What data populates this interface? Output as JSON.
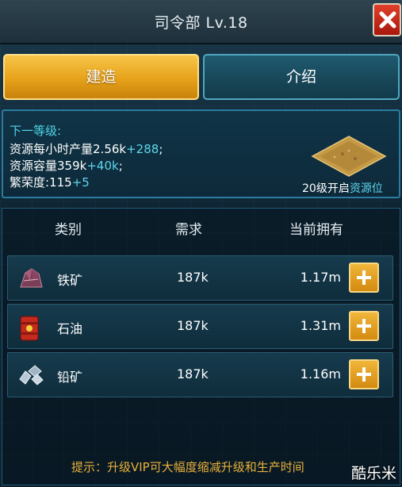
{
  "title": "司令部 Lv.18",
  "tabs": [
    {
      "label": "建造",
      "active": true
    },
    {
      "label": "介绍",
      "active": false
    }
  ],
  "next_level": {
    "heading": "下一等级:",
    "hourly_output": {
      "label": "资源每小时产量",
      "value": "2.56k",
      "bonus": "+288",
      "suffix": ";"
    },
    "capacity": {
      "label": "资源容量",
      "value": "359k",
      "bonus": "+40k",
      "suffix": ";"
    },
    "prosperity": {
      "label": "繁荣度:",
      "value": "115",
      "bonus": "+5"
    },
    "unlock_text": "20级开启",
    "unlock_highlight": "资源位"
  },
  "table": {
    "headers": [
      "类别",
      "需求",
      "当前拥有"
    ],
    "rows": [
      {
        "icon": "iron-ore-icon",
        "name": "铁矿",
        "need": "187k",
        "have": "1.17m"
      },
      {
        "icon": "oil-barrel-icon",
        "name": "石油",
        "need": "187k",
        "have": "1.31m"
      },
      {
        "icon": "lead-ore-icon",
        "name": "铅矿",
        "need": "187k",
        "have": "1.16m"
      }
    ]
  },
  "tip": "提示：升级VIP可大幅度缩减升级和生产时间",
  "watermark": "酷乐米",
  "colors": {
    "accent_gold": "#e7a21a",
    "accent_cyan": "#5fd6ee",
    "tip_color": "#e9b13a",
    "close_red": "#c0241a"
  }
}
